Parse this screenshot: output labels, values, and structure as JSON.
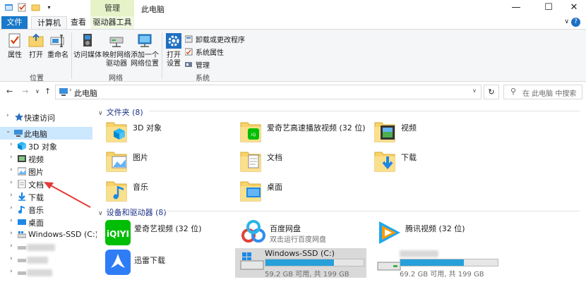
{
  "window": {
    "title": "此电脑",
    "context_tab": "管理",
    "controls": {
      "minimize": "—",
      "maximize": "☐",
      "close": "✕"
    }
  },
  "tabs": {
    "file": "文件",
    "computer": "计算机",
    "view": "查看",
    "drive_tools": "驱动器工具"
  },
  "ribbon": {
    "location": {
      "label": "位置",
      "properties": "属性",
      "open": "打开",
      "rename": "重命名"
    },
    "network": {
      "label": "网络",
      "media": "访问媒体",
      "map_drive_l1": "映射网络",
      "map_drive_l2": "驱动器",
      "add_loc_l1": "添加一个",
      "add_loc_l2": "网络位置"
    },
    "system": {
      "label": "系统",
      "open_settings_l1": "打开",
      "open_settings_l2": "设置",
      "uninstall": "卸载或更改程序",
      "sys_props": "系统属性",
      "manage": "管理"
    }
  },
  "address": {
    "path": "此电脑",
    "search_placeholder": "在 此电脑 中搜索"
  },
  "nav": {
    "quick_access": "快速访问",
    "this_pc": "此电脑",
    "items": [
      "3D 对象",
      "视频",
      "图片",
      "文档",
      "下载",
      "音乐",
      "桌面",
      "Windows-SSD (C:)"
    ]
  },
  "folders": {
    "header": "文件夹 (8)",
    "items": [
      "3D 对象",
      "爱奇艺高速播放视频 (32 位)",
      "视频",
      "图片",
      "文档",
      "下载",
      "音乐",
      "桌面"
    ]
  },
  "devices": {
    "header": "设备和驱动器 (8)",
    "iqiyi": "爱奇艺视频 (32 位)",
    "baidu": "百度网盘",
    "baidu_sub": "双击运行百度网盘",
    "tencent": "腾讯视频 (32 位)",
    "xunlei": "迅雷下载",
    "ssd_name": "Windows-SSD (C:)",
    "ssd_free": "59.2 GB 可用, 共 199 GB",
    "ssd_used_fraction": 0.7,
    "d2_free": "69.2 GB 可用, 共 199 GB",
    "d2_used_fraction": 0.65
  },
  "colors": {
    "accent": "#1979ca",
    "selection": "#cce8ff",
    "context_tab": "#e6f2c7",
    "annotation": "#e53935",
    "bar": "#26a0da"
  }
}
